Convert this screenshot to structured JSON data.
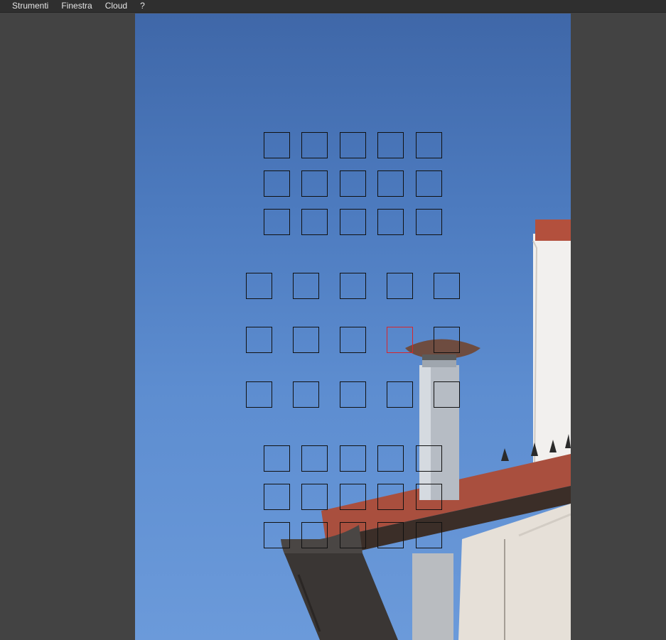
{
  "menubar": {
    "items": [
      {
        "label": "Strumenti"
      },
      {
        "label": "Finestra"
      },
      {
        "label": "Cloud"
      },
      {
        "label": "?"
      }
    ]
  },
  "viewer": {
    "image": "photo-sky-chimney-rooftop",
    "af_grid": {
      "total_points": 45,
      "selected_point": 23,
      "border_color": "#111111",
      "selected_color": "#d8252b"
    }
  },
  "colors": {
    "menubar_bg": "#2f2f2f",
    "workspace_bg": "#434343",
    "sky_top": "#3f67a8",
    "sky_bottom": "#6b9ada"
  }
}
